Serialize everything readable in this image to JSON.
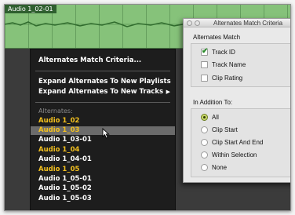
{
  "region": {
    "name": "Audio 1_02-01"
  },
  "menu": {
    "items": [
      {
        "label": "Alternates Match Criteria..."
      },
      {
        "label": "Expand Alternates To New Playlists"
      },
      {
        "label": "Expand Alternates To New Tracks"
      }
    ],
    "alternates_header": "Alternates:",
    "alternates": [
      {
        "label": "Audio 1_02",
        "color": "yellow"
      },
      {
        "label": "Audio 1_03",
        "color": "yellow",
        "hover": true
      },
      {
        "label": "Audio 1_03-01",
        "color": "white"
      },
      {
        "label": "Audio 1_04",
        "color": "yellow"
      },
      {
        "label": "Audio 1_04-01",
        "color": "white"
      },
      {
        "label": "Audio 1_05",
        "color": "yellow"
      },
      {
        "label": "Audio 1_05-01",
        "color": "white"
      },
      {
        "label": "Audio 1_05-02",
        "color": "white"
      },
      {
        "label": "Audio 1_05-03",
        "color": "white"
      }
    ]
  },
  "window": {
    "title": "Alternates Match Criteria",
    "match_label": "Alternates Match",
    "match_options": [
      {
        "label": "Track ID",
        "checked": true
      },
      {
        "label": "Track Name",
        "checked": false
      },
      {
        "label": "Clip Rating",
        "checked": false
      }
    ],
    "addition_label": "In Addition To:",
    "addition_options": [
      {
        "label": "All",
        "selected": true
      },
      {
        "label": "Clip Start",
        "selected": false
      },
      {
        "label": "Clip Start And End",
        "selected": false
      },
      {
        "label": "Within Selection",
        "selected": false
      },
      {
        "label": "None",
        "selected": false
      }
    ]
  },
  "colors": {
    "region_green": "#86c27a",
    "alternate_yellow": "#f4c11f",
    "radio_selected": "#c9d86a"
  }
}
